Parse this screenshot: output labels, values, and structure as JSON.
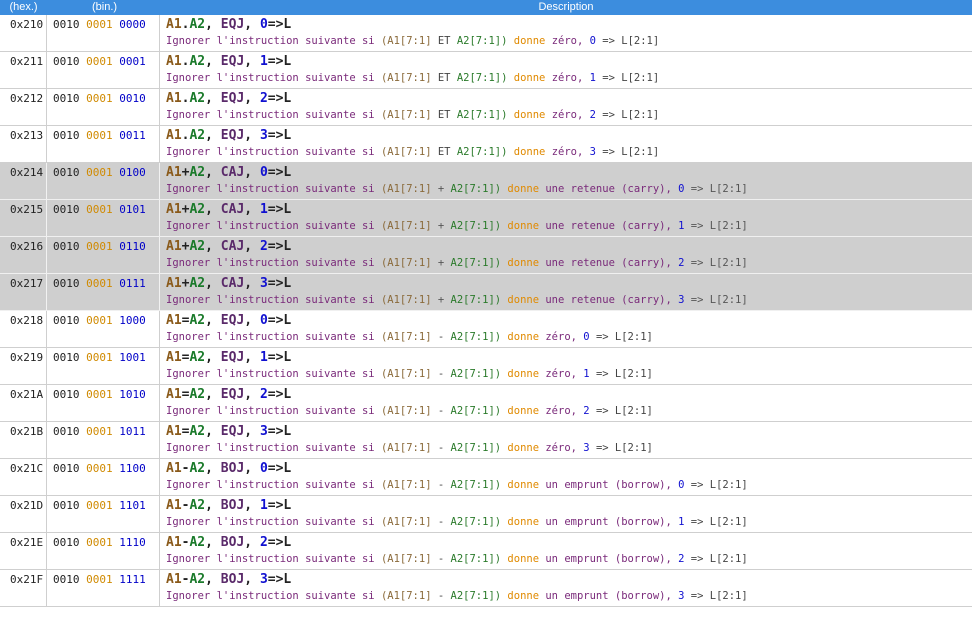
{
  "header": {
    "hex": "(hex.)",
    "bin": "(bin.)",
    "desc": "Description"
  },
  "rows": [
    {
      "hex": "0x210",
      "bin": [
        "0010",
        "0001",
        "0000"
      ],
      "mn": {
        "a1": "A1",
        "sep": ".",
        "a2": "A2",
        "op": "EQJ",
        "imm": "0"
      },
      "ds": {
        "pre": "Ignorer l'instruction suivante si",
        "a1": "(A1[7:1]",
        "mid": "ET",
        "a2": "A2[7:1])",
        "kw": "donne",
        "rest": "zéro,",
        "num": "0",
        "tail": "=> L[2:1]"
      },
      "hl": false
    },
    {
      "hex": "0x211",
      "bin": [
        "0010",
        "0001",
        "0001"
      ],
      "mn": {
        "a1": "A1",
        "sep": ".",
        "a2": "A2",
        "op": "EQJ",
        "imm": "1"
      },
      "ds": {
        "pre": "Ignorer l'instruction suivante si",
        "a1": "(A1[7:1]",
        "mid": "ET",
        "a2": "A2[7:1])",
        "kw": "donne",
        "rest": "zéro,",
        "num": "1",
        "tail": "=> L[2:1]"
      },
      "hl": false
    },
    {
      "hex": "0x212",
      "bin": [
        "0010",
        "0001",
        "0010"
      ],
      "mn": {
        "a1": "A1",
        "sep": ".",
        "a2": "A2",
        "op": "EQJ",
        "imm": "2"
      },
      "ds": {
        "pre": "Ignorer l'instruction suivante si",
        "a1": "(A1[7:1]",
        "mid": "ET",
        "a2": "A2[7:1])",
        "kw": "donne",
        "rest": "zéro,",
        "num": "2",
        "tail": "=> L[2:1]"
      },
      "hl": false
    },
    {
      "hex": "0x213",
      "bin": [
        "0010",
        "0001",
        "0011"
      ],
      "mn": {
        "a1": "A1",
        "sep": ".",
        "a2": "A2",
        "op": "EQJ",
        "imm": "3"
      },
      "ds": {
        "pre": "Ignorer l'instruction suivante si",
        "a1": "(A1[7:1]",
        "mid": "ET",
        "a2": "A2[7:1])",
        "kw": "donne",
        "rest": "zéro,",
        "num": "3",
        "tail": "=> L[2:1]"
      },
      "hl": false
    },
    {
      "hex": "0x214",
      "bin": [
        "0010",
        "0001",
        "0100"
      ],
      "mn": {
        "a1": "A1",
        "sep": "+",
        "a2": "A2",
        "op": "CAJ",
        "imm": "0"
      },
      "ds": {
        "pre": "Ignorer l'instruction suivante si",
        "a1": "(A1[7:1]",
        "mid": "+",
        "a2": "A2[7:1])",
        "kw": "donne",
        "rest": "une retenue (carry),",
        "num": "0",
        "tail": "=> L[2:1]"
      },
      "hl": true
    },
    {
      "hex": "0x215",
      "bin": [
        "0010",
        "0001",
        "0101"
      ],
      "mn": {
        "a1": "A1",
        "sep": "+",
        "a2": "A2",
        "op": "CAJ",
        "imm": "1"
      },
      "ds": {
        "pre": "Ignorer l'instruction suivante si",
        "a1": "(A1[7:1]",
        "mid": "+",
        "a2": "A2[7:1])",
        "kw": "donne",
        "rest": "une retenue (carry),",
        "num": "1",
        "tail": "=> L[2:1]"
      },
      "hl": true
    },
    {
      "hex": "0x216",
      "bin": [
        "0010",
        "0001",
        "0110"
      ],
      "mn": {
        "a1": "A1",
        "sep": "+",
        "a2": "A2",
        "op": "CAJ",
        "imm": "2"
      },
      "ds": {
        "pre": "Ignorer l'instruction suivante si",
        "a1": "(A1[7:1]",
        "mid": "+",
        "a2": "A2[7:1])",
        "kw": "donne",
        "rest": "une retenue (carry),",
        "num": "2",
        "tail": "=> L[2:1]"
      },
      "hl": true
    },
    {
      "hex": "0x217",
      "bin": [
        "0010",
        "0001",
        "0111"
      ],
      "mn": {
        "a1": "A1",
        "sep": "+",
        "a2": "A2",
        "op": "CAJ",
        "imm": "3"
      },
      "ds": {
        "pre": "Ignorer l'instruction suivante si",
        "a1": "(A1[7:1]",
        "mid": "+",
        "a2": "A2[7:1])",
        "kw": "donne",
        "rest": "une retenue (carry),",
        "num": "3",
        "tail": "=> L[2:1]"
      },
      "hl": true
    },
    {
      "hex": "0x218",
      "bin": [
        "0010",
        "0001",
        "1000"
      ],
      "mn": {
        "a1": "A1",
        "sep": "=",
        "a2": "A2",
        "op": "EQJ",
        "imm": "0"
      },
      "ds": {
        "pre": "Ignorer l'instruction suivante si",
        "a1": "(A1[7:1]",
        "mid": "-",
        "a2": "A2[7:1])",
        "kw": "donne",
        "rest": "zéro,",
        "num": "0",
        "tail": "=> L[2:1]"
      },
      "hl": false
    },
    {
      "hex": "0x219",
      "bin": [
        "0010",
        "0001",
        "1001"
      ],
      "mn": {
        "a1": "A1",
        "sep": "=",
        "a2": "A2",
        "op": "EQJ",
        "imm": "1"
      },
      "ds": {
        "pre": "Ignorer l'instruction suivante si",
        "a1": "(A1[7:1]",
        "mid": "-",
        "a2": "A2[7:1])",
        "kw": "donne",
        "rest": "zéro,",
        "num": "1",
        "tail": "=> L[2:1]"
      },
      "hl": false
    },
    {
      "hex": "0x21A",
      "bin": [
        "0010",
        "0001",
        "1010"
      ],
      "mn": {
        "a1": "A1",
        "sep": "=",
        "a2": "A2",
        "op": "EQJ",
        "imm": "2"
      },
      "ds": {
        "pre": "Ignorer l'instruction suivante si",
        "a1": "(A1[7:1]",
        "mid": "-",
        "a2": "A2[7:1])",
        "kw": "donne",
        "rest": "zéro,",
        "num": "2",
        "tail": "=> L[2:1]"
      },
      "hl": false
    },
    {
      "hex": "0x21B",
      "bin": [
        "0010",
        "0001",
        "1011"
      ],
      "mn": {
        "a1": "A1",
        "sep": "=",
        "a2": "A2",
        "op": "EQJ",
        "imm": "3"
      },
      "ds": {
        "pre": "Ignorer l'instruction suivante si",
        "a1": "(A1[7:1]",
        "mid": "-",
        "a2": "A2[7:1])",
        "kw": "donne",
        "rest": "zéro,",
        "num": "3",
        "tail": "=> L[2:1]"
      },
      "hl": false
    },
    {
      "hex": "0x21C",
      "bin": [
        "0010",
        "0001",
        "1100"
      ],
      "mn": {
        "a1": "A1",
        "sep": "-",
        "a2": "A2",
        "op": "BOJ",
        "imm": "0"
      },
      "ds": {
        "pre": "Ignorer l'instruction suivante si",
        "a1": "(A1[7:1]",
        "mid": "-",
        "a2": "A2[7:1])",
        "kw": "donne",
        "rest": "un emprunt (borrow),",
        "num": "0",
        "tail": "=> L[2:1]"
      },
      "hl": false
    },
    {
      "hex": "0x21D",
      "bin": [
        "0010",
        "0001",
        "1101"
      ],
      "mn": {
        "a1": "A1",
        "sep": "-",
        "a2": "A2",
        "op": "BOJ",
        "imm": "1"
      },
      "ds": {
        "pre": "Ignorer l'instruction suivante si",
        "a1": "(A1[7:1]",
        "mid": "-",
        "a2": "A2[7:1])",
        "kw": "donne",
        "rest": "un emprunt (borrow),",
        "num": "1",
        "tail": "=> L[2:1]"
      },
      "hl": false
    },
    {
      "hex": "0x21E",
      "bin": [
        "0010",
        "0001",
        "1110"
      ],
      "mn": {
        "a1": "A1",
        "sep": "-",
        "a2": "A2",
        "op": "BOJ",
        "imm": "2"
      },
      "ds": {
        "pre": "Ignorer l'instruction suivante si",
        "a1": "(A1[7:1]",
        "mid": "-",
        "a2": "A2[7:1])",
        "kw": "donne",
        "rest": "un emprunt (borrow),",
        "num": "2",
        "tail": "=> L[2:1]"
      },
      "hl": false
    },
    {
      "hex": "0x21F",
      "bin": [
        "0010",
        "0001",
        "1111"
      ],
      "mn": {
        "a1": "A1",
        "sep": "-",
        "a2": "A2",
        "op": "BOJ",
        "imm": "3"
      },
      "ds": {
        "pre": "Ignorer l'instruction suivante si",
        "a1": "(A1[7:1]",
        "mid": "-",
        "a2": "A2[7:1])",
        "kw": "donne",
        "rest": "un emprunt (borrow),",
        "num": "3",
        "tail": "=> L[2:1]"
      },
      "hl": false
    }
  ],
  "colors": {
    "header_bg": "#3c8dde",
    "highlight_bg": "#cfcfcf"
  }
}
